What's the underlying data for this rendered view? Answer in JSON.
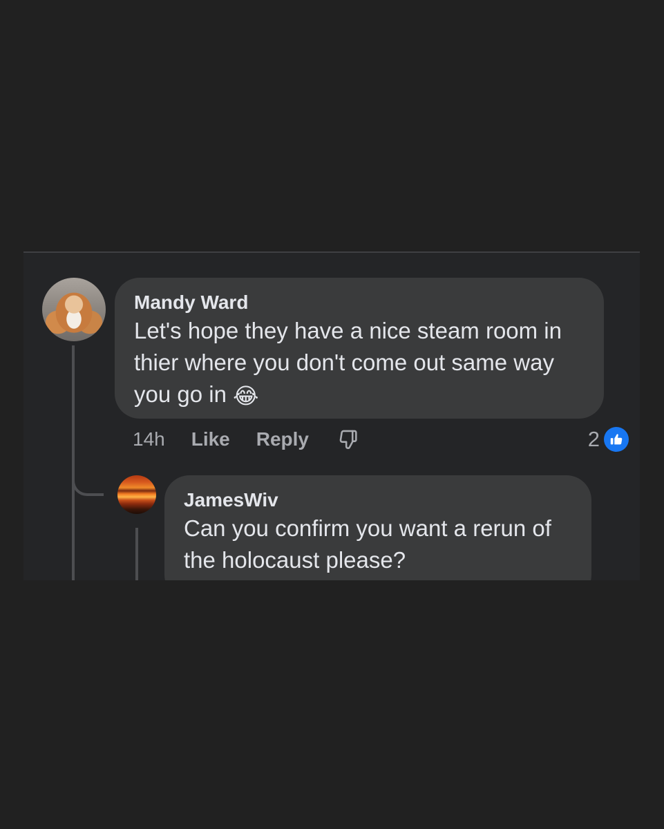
{
  "comments": [
    {
      "author": "Mandy Ward",
      "text": "Let's hope they have a nice steam room in thier where you don't come out same way you go in",
      "emoji": "😂",
      "time": "14h",
      "like_label": "Like",
      "reply_label": "Reply",
      "reaction_count": "2",
      "reaction_icon": "like-thumb-icon"
    },
    {
      "author": "JamesWiv",
      "text": "Can you confirm you want a rerun of the holocaust please?"
    }
  ],
  "colors": {
    "background": "#212121",
    "panel": "#242527",
    "bubble": "#3a3b3c",
    "text": "#e4e6eb",
    "muted": "#a9abb0",
    "like_blue": "#1877f2"
  }
}
